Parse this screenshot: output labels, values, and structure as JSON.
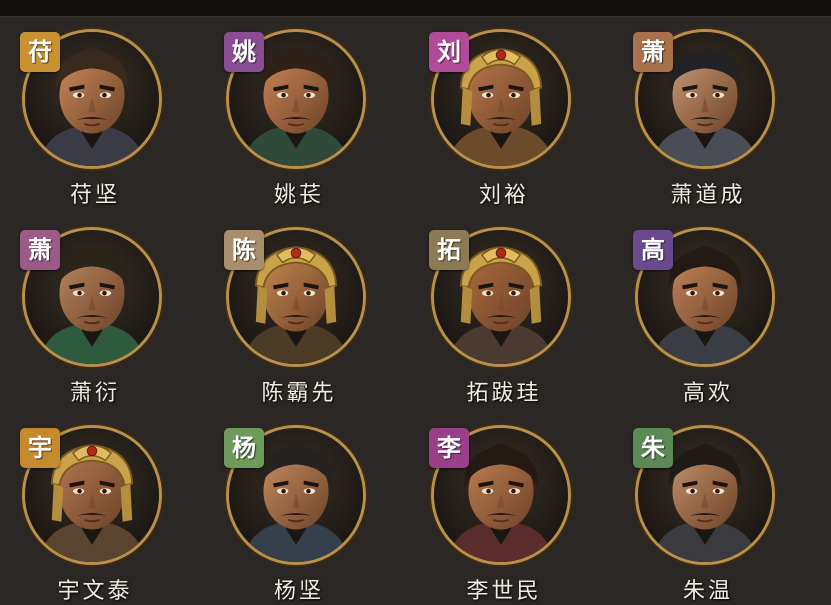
{
  "colors": {
    "background": "#2b2724",
    "ring": "#b8904b",
    "name_text": "#f1ece2"
  },
  "characters": [
    {
      "badge": "苻",
      "name": "苻坚",
      "badge_color": "#c9912f",
      "helmet": false,
      "hair": "#3a2a1e",
      "skin": "#c98a5a",
      "cloth": "#3b3b46",
      "icon": "bearded-official-icon"
    },
    {
      "badge": "姚",
      "name": "姚苌",
      "badge_color": "#8a4d94",
      "helmet": false,
      "hair": "#2d2118",
      "skin": "#c98456",
      "cloth": "#2f4a3a",
      "icon": "mustached-official-icon"
    },
    {
      "badge": "刘",
      "name": "刘裕",
      "badge_color": "#b24a9a",
      "helmet": true,
      "hair": "#2a1f18",
      "skin": "#b9774a",
      "cloth": "#6b4b2a",
      "icon": "golden-helmet-general-icon"
    },
    {
      "badge": "萧",
      "name": "萧道成",
      "badge_color": "#a7714c",
      "helmet": false,
      "hair": "#222226",
      "skin": "#c89874",
      "cloth": "#4a4c56",
      "icon": "crowned-scholar-icon"
    },
    {
      "badge": "萧",
      "name": "萧衍",
      "badge_color": "#9c5a86",
      "helmet": false,
      "hair": "#2b2419",
      "skin": "#b98660",
      "cloth": "#2e5a3d",
      "icon": "bearded-elder-icon"
    },
    {
      "badge": "陈",
      "name": "陈霸先",
      "badge_color": "#a88e6a",
      "helmet": true,
      "hair": "#241c15",
      "skin": "#c4874f",
      "cloth": "#4b3a26",
      "icon": "golden-helmet-warrior-icon"
    },
    {
      "badge": "拓",
      "name": "拓跋珪",
      "badge_color": "#8c7a55",
      "helmet": true,
      "hair": "#1e1812",
      "skin": "#a9693f",
      "cloth": "#4a3a30",
      "icon": "fur-helmet-chieftain-icon"
    },
    {
      "badge": "高",
      "name": "高欢",
      "badge_color": "#6a4a8f",
      "helmet": false,
      "hair": "#231a14",
      "skin": "#c3855a",
      "cloth": "#3a3d44",
      "icon": "long-haired-lord-icon"
    },
    {
      "badge": "宇",
      "name": "宇文泰",
      "badge_color": "#c58a2b",
      "helmet": true,
      "hair": "#231c15",
      "skin": "#b27750",
      "cloth": "#5a4630",
      "icon": "gold-helmet-commander-icon"
    },
    {
      "badge": "杨",
      "name": "杨坚",
      "badge_color": "#6e9a5a",
      "helmet": false,
      "hair": "#262220",
      "skin": "#c58c60",
      "cloth": "#36404c",
      "icon": "emperor-yang-icon"
    },
    {
      "badge": "李",
      "name": "李世民",
      "badge_color": "#9a3f8a",
      "helmet": false,
      "hair": "#241a13",
      "skin": "#bf7f52",
      "cloth": "#5b2c2c",
      "icon": "young-emperor-icon"
    },
    {
      "badge": "朱",
      "name": "朱温",
      "badge_color": "#5b8a55",
      "helmet": false,
      "hair": "#1f1a16",
      "skin": "#c2906a",
      "cloth": "#3a3a3f",
      "icon": "scarred-warlord-icon"
    }
  ]
}
